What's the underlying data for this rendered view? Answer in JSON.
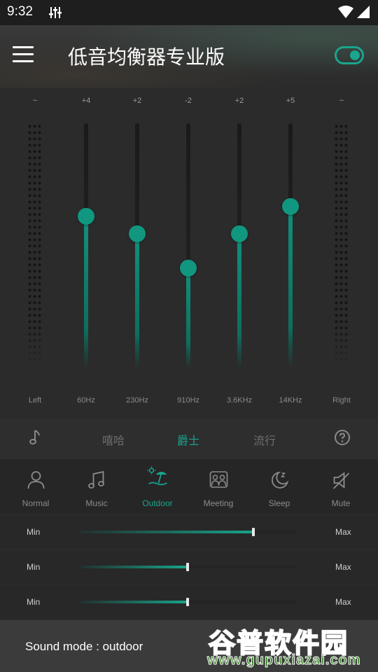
{
  "status": {
    "time": "9:32"
  },
  "header": {
    "title": "低音均衡器专业版",
    "enabled": true
  },
  "colors": {
    "accent": "#19a58e",
    "background": "#2b2b2b"
  },
  "equalizer": {
    "left_label": "Left",
    "right_label": "Right",
    "side_symbol": "~",
    "bands": [
      {
        "freq": "60Hz",
        "gain_label": "+4",
        "level": 0.62
      },
      {
        "freq": "230Hz",
        "gain_label": "+2",
        "level": 0.55
      },
      {
        "freq": "910Hz",
        "gain_label": "-2",
        "level": 0.41
      },
      {
        "freq": "3.6KHz",
        "gain_label": "+2",
        "level": 0.55
      },
      {
        "freq": "14KHz",
        "gain_label": "+5",
        "level": 0.66
      }
    ]
  },
  "genres": {
    "icon_left": "music-note-icon",
    "items": [
      "嘻哈",
      "爵士",
      "流行"
    ],
    "active_index": 1,
    "icon_right": "help-icon"
  },
  "modes": {
    "items": [
      {
        "label": "Normal",
        "icon": "person-icon"
      },
      {
        "label": "Music",
        "icon": "music-notes-icon"
      },
      {
        "label": "Outdoor",
        "icon": "beach-icon"
      },
      {
        "label": "Meeting",
        "icon": "meeting-icon"
      },
      {
        "label": "Sleep",
        "icon": "moon-icon"
      },
      {
        "label": "Mute",
        "icon": "mute-icon"
      }
    ],
    "active_index": 2
  },
  "sliders": [
    {
      "min_label": "Min",
      "max_label": "Max",
      "value": 0.8
    },
    {
      "min_label": "Min",
      "max_label": "Max",
      "value": 0.5
    },
    {
      "min_label": "Min",
      "max_label": "Max",
      "value": 0.5
    }
  ],
  "footer": {
    "text": "Sound mode : outdoor"
  },
  "watermark": {
    "top": "谷普软件园",
    "bottom": "www.gupuxiazai.com"
  }
}
